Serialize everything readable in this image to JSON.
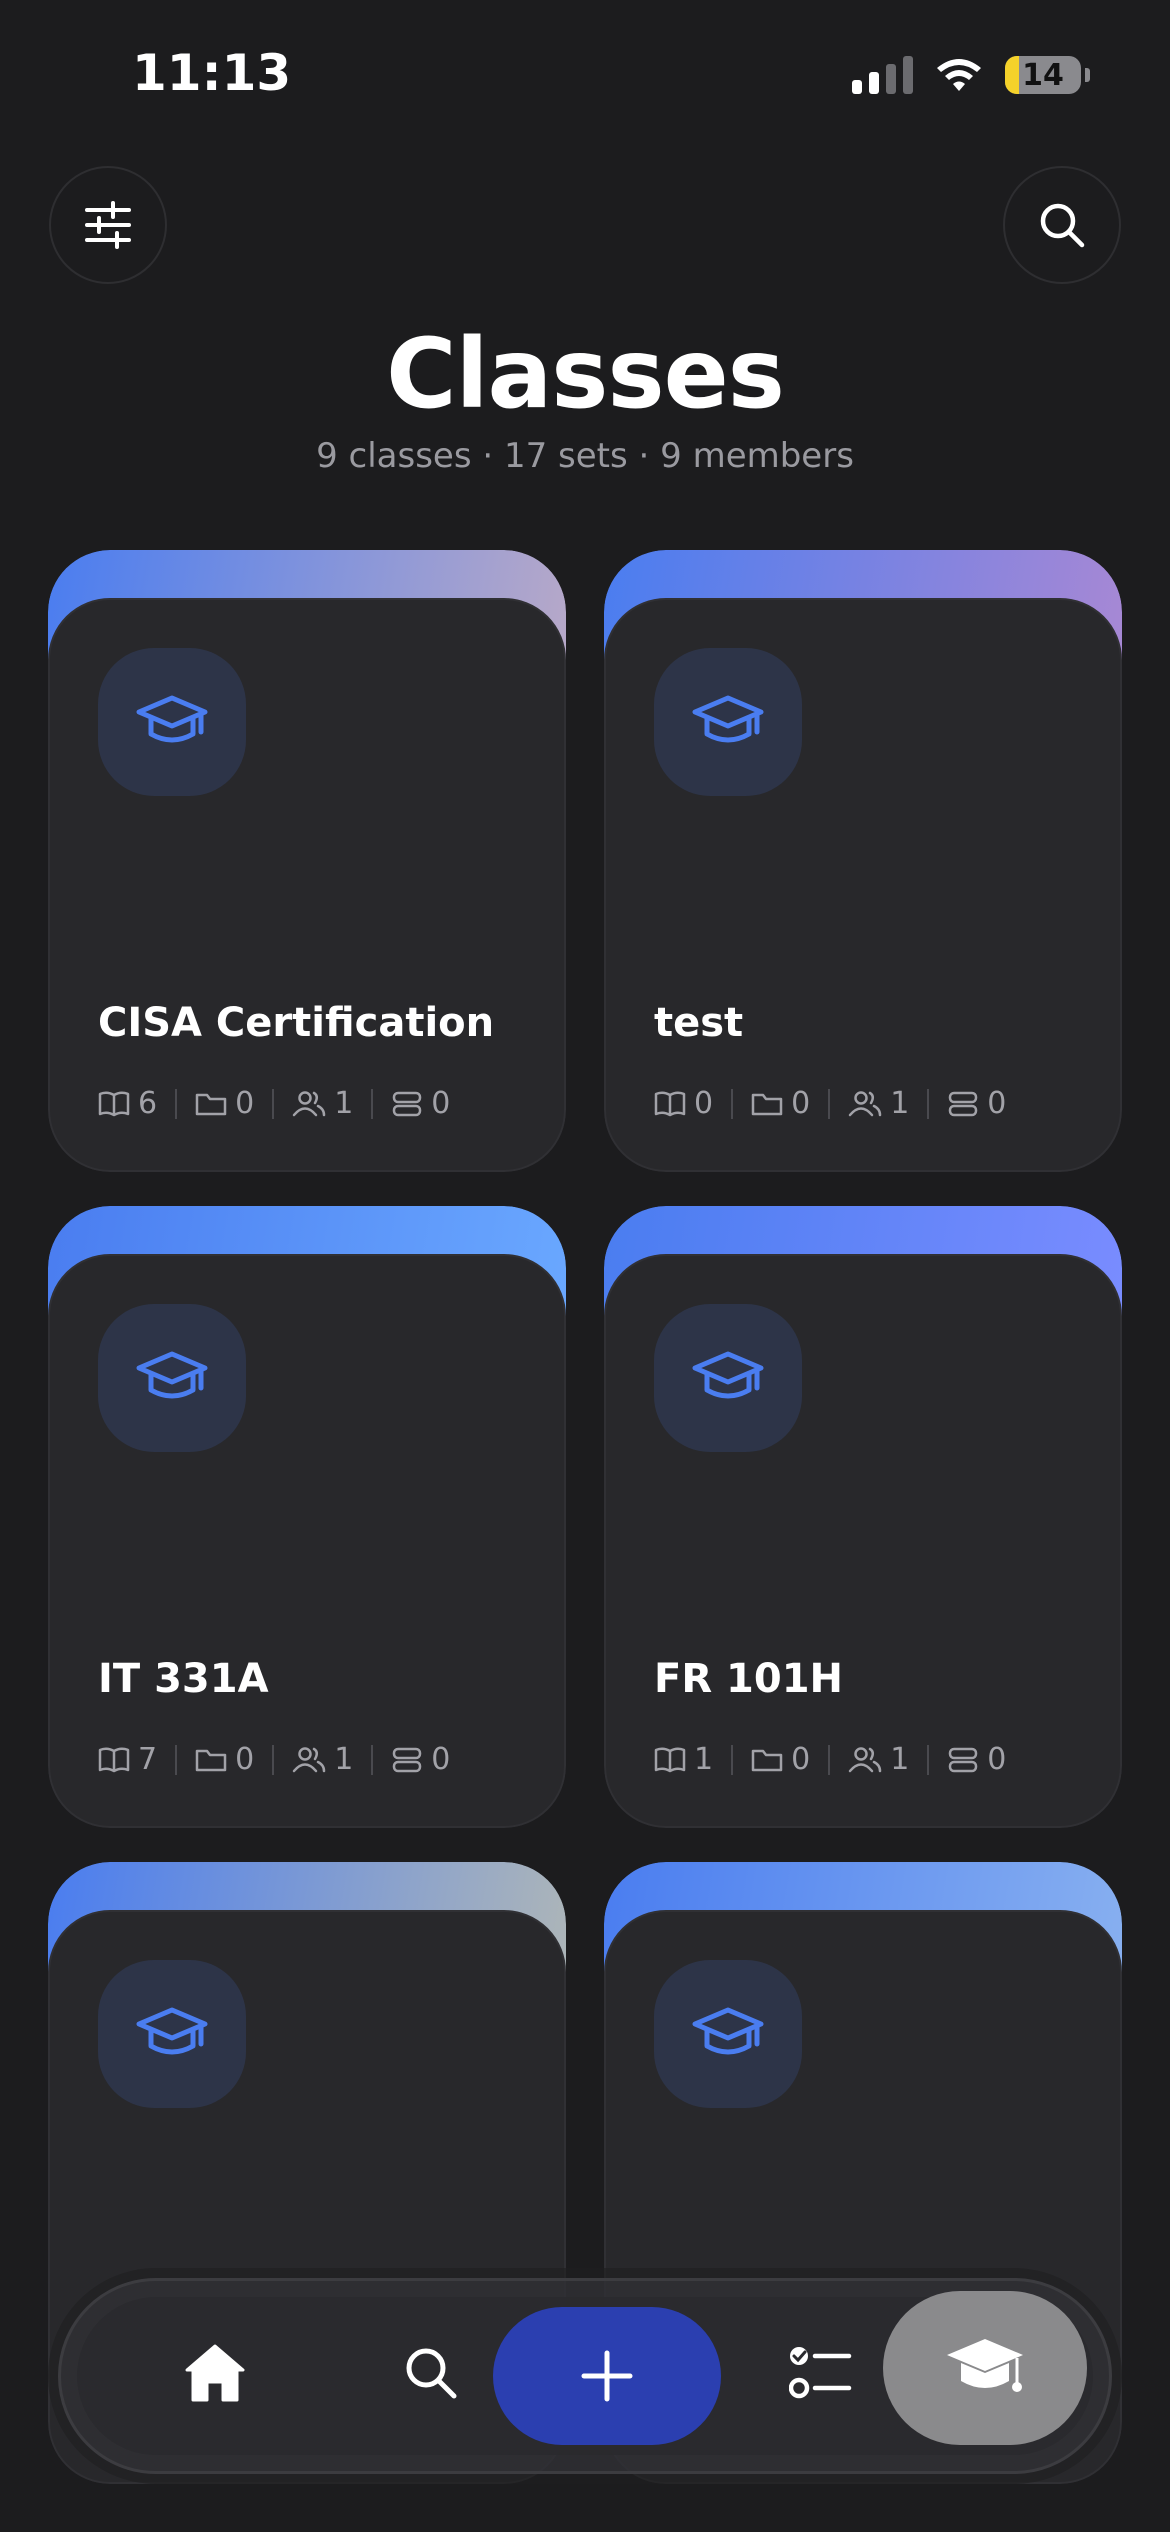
{
  "status_bar": {
    "time": "11:13",
    "battery": "14"
  },
  "header": {
    "title": "Classes",
    "subtitle": "9 classes · 17 sets · 9 members"
  },
  "colors": {
    "accent": "#4a7df0",
    "card_bg": "#28282b",
    "icon_bg": "#2d3448",
    "add_button": "#2b3fb0"
  },
  "cards": [
    {
      "title": "CISA Certification",
      "sets": "6",
      "folders": "0",
      "members": "1",
      "other": "0",
      "gradient_end": "#b8a9c8"
    },
    {
      "title": "test",
      "sets": "0",
      "folders": "0",
      "members": "1",
      "other": "0",
      "gradient_end": "#a888d4"
    },
    {
      "title": "IT 331A",
      "sets": "7",
      "folders": "0",
      "members": "1",
      "other": "0",
      "gradient_end": "#6aa8ff"
    },
    {
      "title": "FR 101H",
      "sets": "1",
      "folders": "0",
      "members": "1",
      "other": "0",
      "gradient_end": "#7a8cff"
    },
    {
      "title": "",
      "sets": "",
      "folders": "",
      "members": "",
      "other": "",
      "gradient_end": "#aeb6b8"
    },
    {
      "title": "",
      "sets": "",
      "folders": "",
      "members": "",
      "other": "",
      "gradient_end": "#88b0f0"
    }
  ],
  "nav": {
    "items": [
      "home-icon",
      "search-icon",
      "plus-icon",
      "checklist-icon",
      "graduation-cap-icon"
    ],
    "active": "graduation-cap-icon"
  }
}
